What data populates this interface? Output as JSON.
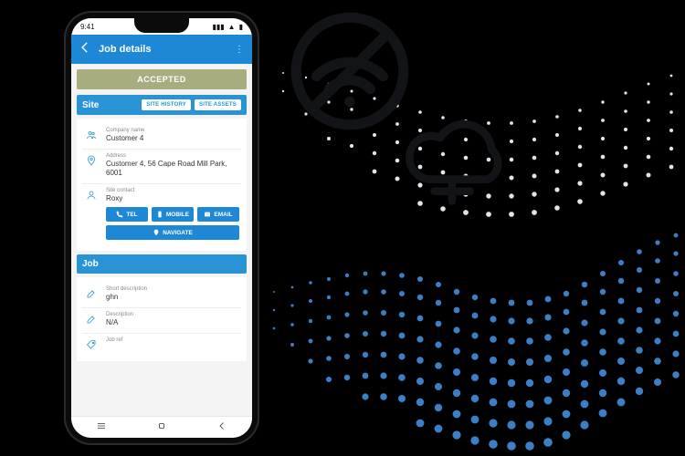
{
  "statusbar": {
    "time": "9:41"
  },
  "appbar": {
    "title": "Job details"
  },
  "status_banner": "ACCEPTED",
  "site": {
    "header": "Site",
    "history_btn": "SITE HISTORY",
    "assets_btn": "SITE ASSETS",
    "company_label": "Company name",
    "company_value": "Customer 4",
    "address_label": "Address",
    "address_value": "Customer 4, 56 Cape Road Mill Park, 6001",
    "contact_label": "Site contact",
    "contact_value": "Roxy",
    "tel_btn": "TEL",
    "mobile_btn": "MOBILE",
    "email_btn": "EMAIL",
    "navigate_btn": "NAVIGATE"
  },
  "job": {
    "header": "Job",
    "short_label": "Short description",
    "short_value": "ghn",
    "desc_label": "Description",
    "desc_value": "N/A",
    "ref_label": "Job ref"
  }
}
